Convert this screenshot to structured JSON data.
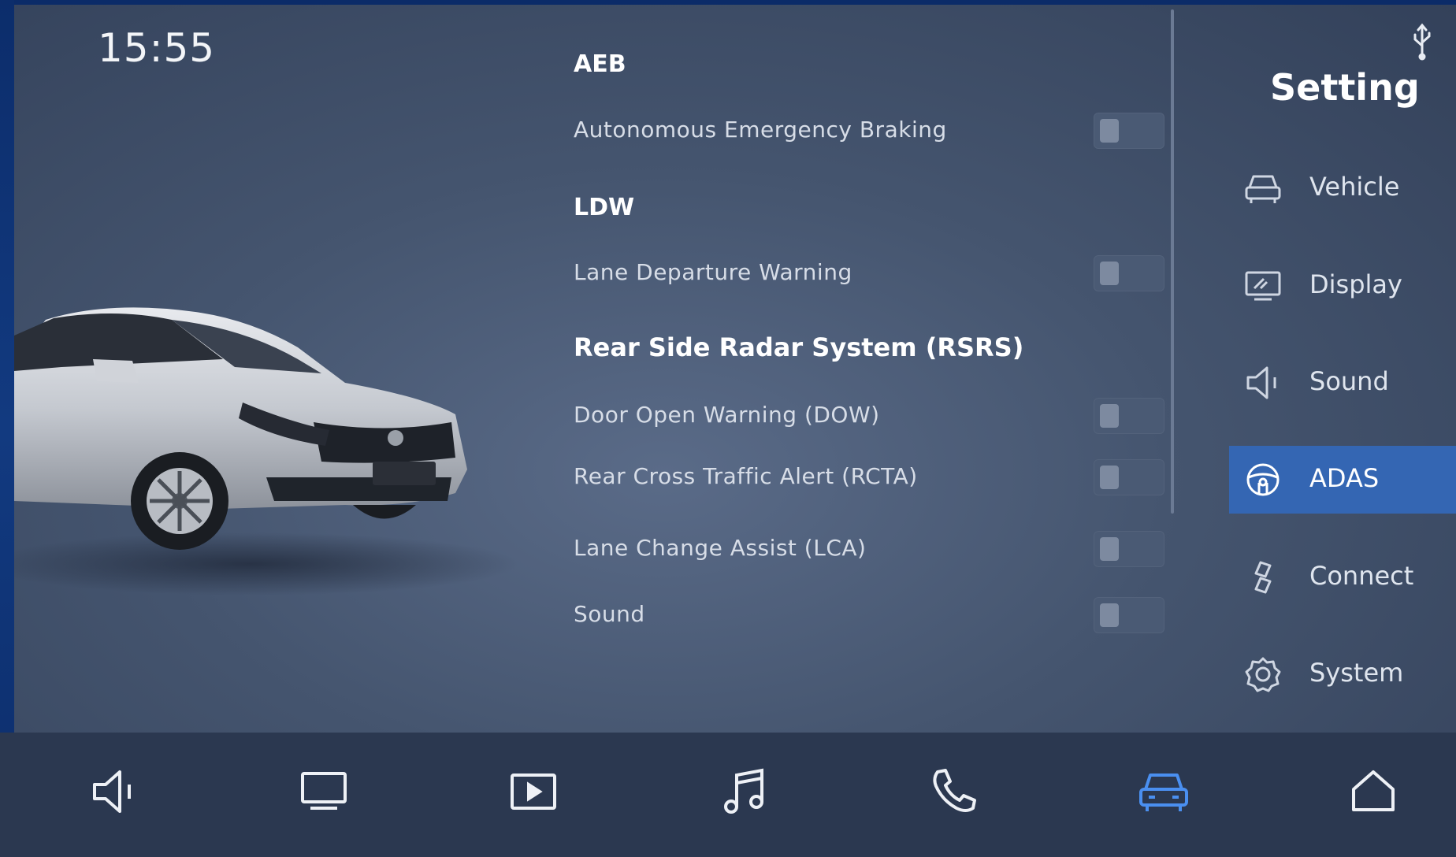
{
  "status": {
    "time": "15:55"
  },
  "settings": {
    "sections": [
      {
        "title": "AEB",
        "rows": [
          {
            "label": "Autonomous Emergency Braking",
            "enabled": false
          }
        ]
      },
      {
        "title": "LDW",
        "rows": [
          {
            "label": "Lane Departure Warning",
            "enabled": false
          }
        ]
      },
      {
        "title": "Rear Side Radar System (RSRS)",
        "rows": [
          {
            "label": "Door Open Warning (DOW)",
            "enabled": false
          },
          {
            "label": "Rear Cross Traffic Alert (RCTA)",
            "enabled": false
          },
          {
            "label": "Lane Change Assist (LCA)",
            "enabled": false
          },
          {
            "label": "Sound",
            "enabled": false
          }
        ]
      }
    ]
  },
  "menu": {
    "title": "Setting",
    "items": [
      {
        "label": "Vehicle",
        "icon": "car-icon",
        "active": false
      },
      {
        "label": "Display",
        "icon": "display-icon",
        "active": false
      },
      {
        "label": "Sound",
        "icon": "speaker-icon",
        "active": false
      },
      {
        "label": "ADAS",
        "icon": "steering-wheel-icon",
        "active": true
      },
      {
        "label": "Connect",
        "icon": "link-icon",
        "active": false
      },
      {
        "label": "System",
        "icon": "gear-icon",
        "active": false
      }
    ]
  },
  "dock": {
    "items": [
      {
        "icon": "speaker-icon"
      },
      {
        "icon": "monitor-icon"
      },
      {
        "icon": "video-play-icon"
      },
      {
        "icon": "music-note-icon"
      },
      {
        "icon": "phone-icon"
      },
      {
        "icon": "car-icon",
        "active": true
      },
      {
        "icon": "home-icon"
      }
    ]
  },
  "colors": {
    "accent": "#3466b3",
    "active_icon": "#4a8ff0"
  }
}
